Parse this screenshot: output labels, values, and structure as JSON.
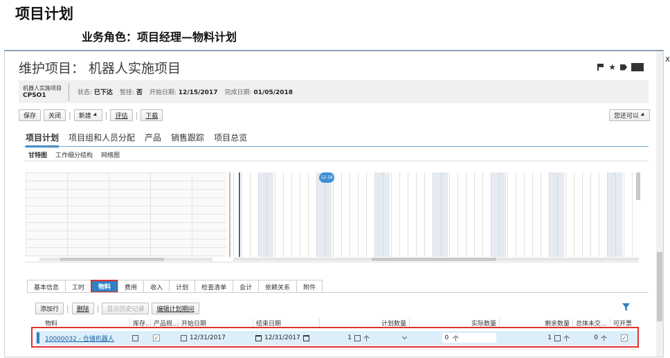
{
  "slide": {
    "title": "项目计划",
    "subtitle": "业务角色：项目经理—物料计划"
  },
  "app": {
    "header_title": "维护项目： 机器人实施项目",
    "outer_close": "x"
  },
  "info": {
    "project_name": "机器人实施项目",
    "project_code": "CPSO1",
    "status_label": "状态:",
    "status_value": "已下达",
    "pause_label": "暂挂:",
    "pause_value": "否",
    "start_label": "开始日期:",
    "start_value": "12/15/2017",
    "finish_label": "完成日期:",
    "finish_value": "01/05/2018"
  },
  "toolbar": {
    "save": "保存",
    "close": "关闭",
    "new": "新建",
    "evaluate": "评估",
    "download": "下载",
    "more": "您还可以"
  },
  "main_tabs": [
    "项目计划",
    "项目组和人员分配",
    "产品",
    "销售跟踪",
    "项目总览"
  ],
  "sub_tabs": [
    "甘特图",
    "工作细分结构",
    "网络图"
  ],
  "gantt": {
    "date_bubble": "12-18"
  },
  "detail_tabs": [
    "基本信息",
    "工时",
    "物料",
    "费用",
    "收入",
    "计划",
    "检查清单",
    "会计",
    "依赖关系",
    "附件"
  ],
  "materials": {
    "add_row": "添加行",
    "delete": "删除",
    "show_history": "显示历史记录",
    "edit_period": "编辑计划期间",
    "columns": [
      "物料",
      "库存...",
      "产品规...",
      "开始日期",
      "结束日期",
      "计划数量",
      "实际数量",
      "剩余数量",
      "总体未交...",
      "可开票"
    ],
    "row": {
      "material": "10000032 - 仓储机器人",
      "start_date": "12/31/2017",
      "end_date": "12/31/2017",
      "planned_qty": "1",
      "planned_unit": "个",
      "actual_qty": "0",
      "actual_unit": "个",
      "remaining_qty": "1",
      "remaining_unit": "个",
      "open_qty": "0",
      "open_unit": "个"
    }
  }
}
